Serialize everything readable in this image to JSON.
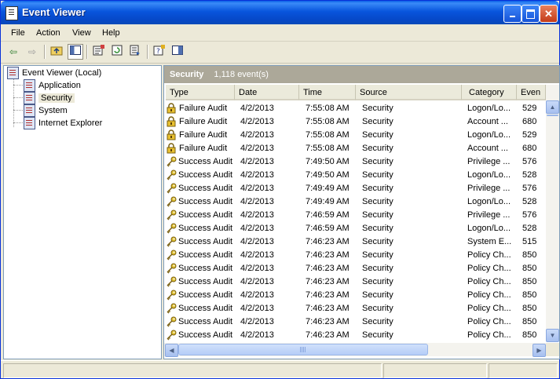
{
  "window": {
    "title": "Event Viewer"
  },
  "menu": [
    "File",
    "Action",
    "View",
    "Help"
  ],
  "tree": {
    "root": "Event Viewer (Local)",
    "children": [
      "Application",
      "Security",
      "System",
      "Internet Explorer"
    ],
    "selected": "Security"
  },
  "pane": {
    "title": "Security",
    "count": "1,118 event(s)"
  },
  "columns": [
    "Type",
    "Date",
    "Time",
    "Source",
    "Category",
    "Even"
  ],
  "rows": [
    [
      "Failure Audit",
      "4/2/2013",
      "7:55:08 AM",
      "Security",
      "Logon/Lo...",
      "529"
    ],
    [
      "Failure Audit",
      "4/2/2013",
      "7:55:08 AM",
      "Security",
      "Account ...",
      "680"
    ],
    [
      "Failure Audit",
      "4/2/2013",
      "7:55:08 AM",
      "Security",
      "Logon/Lo...",
      "529"
    ],
    [
      "Failure Audit",
      "4/2/2013",
      "7:55:08 AM",
      "Security",
      "Account ...",
      "680"
    ],
    [
      "Success Audit",
      "4/2/2013",
      "7:49:50 AM",
      "Security",
      "Privilege ...",
      "576"
    ],
    [
      "Success Audit",
      "4/2/2013",
      "7:49:50 AM",
      "Security",
      "Logon/Lo...",
      "528"
    ],
    [
      "Success Audit",
      "4/2/2013",
      "7:49:49 AM",
      "Security",
      "Privilege ...",
      "576"
    ],
    [
      "Success Audit",
      "4/2/2013",
      "7:49:49 AM",
      "Security",
      "Logon/Lo...",
      "528"
    ],
    [
      "Success Audit",
      "4/2/2013",
      "7:46:59 AM",
      "Security",
      "Privilege ...",
      "576"
    ],
    [
      "Success Audit",
      "4/2/2013",
      "7:46:59 AM",
      "Security",
      "Logon/Lo...",
      "528"
    ],
    [
      "Success Audit",
      "4/2/2013",
      "7:46:23 AM",
      "Security",
      "System E...",
      "515"
    ],
    [
      "Success Audit",
      "4/2/2013",
      "7:46:23 AM",
      "Security",
      "Policy Ch...",
      "850"
    ],
    [
      "Success Audit",
      "4/2/2013",
      "7:46:23 AM",
      "Security",
      "Policy Ch...",
      "850"
    ],
    [
      "Success Audit",
      "4/2/2013",
      "7:46:23 AM",
      "Security",
      "Policy Ch...",
      "850"
    ],
    [
      "Success Audit",
      "4/2/2013",
      "7:46:23 AM",
      "Security",
      "Policy Ch...",
      "850"
    ],
    [
      "Success Audit",
      "4/2/2013",
      "7:46:23 AM",
      "Security",
      "Policy Ch...",
      "850"
    ],
    [
      "Success Audit",
      "4/2/2013",
      "7:46:23 AM",
      "Security",
      "Policy Ch...",
      "850"
    ],
    [
      "Success Audit",
      "4/2/2013",
      "7:46:23 AM",
      "Security",
      "Policy Ch...",
      "850"
    ]
  ],
  "icons": {
    "failure": "lock-icon",
    "success": "key-icon"
  },
  "colors": {
    "titlebar": "#0855dd",
    "pane_header": "#aca899",
    "window_bg": "#ece9d8"
  }
}
